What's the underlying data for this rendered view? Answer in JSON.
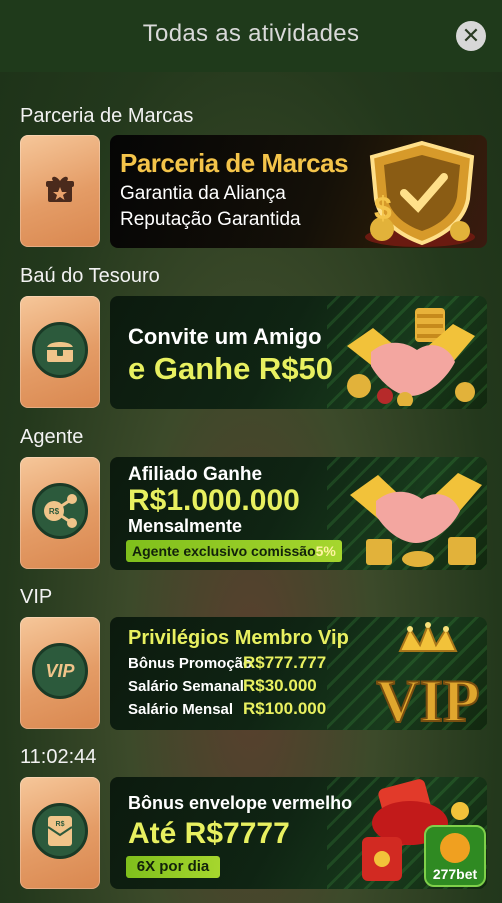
{
  "header": {
    "title": "Todas as atividades",
    "close_icon": "close-icon"
  },
  "sections": [
    {
      "label": "Parceria de Marcas",
      "tile_icon": "gift-icon",
      "banner": {
        "headline": "Parceria de Marcas",
        "line1": "Garantia da Aliança",
        "line2": "Reputação Garantida"
      }
    },
    {
      "label": "Baú do Tesouro",
      "tile_icon": "treasure-chest-icon",
      "banner": {
        "line1": "Convite um Amigo",
        "line2": "e Ganhe R$50"
      }
    },
    {
      "label": "Agente",
      "tile_icon": "share-icon",
      "tile_icon_text": "R$",
      "banner": {
        "line1": "Afiliado Ganhe",
        "line2": "R$1.000.000",
        "line3": "Mensalmente",
        "pill": "Agente exclusivo comissão",
        "pill_value": "5%"
      }
    },
    {
      "label": "VIP",
      "tile_icon": "vip-icon",
      "tile_icon_text": "VIP",
      "banner": {
        "headline": "Privilégios Membro Vip",
        "rows": [
          {
            "label": "Bônus Promoção",
            "value": "R$777.777"
          },
          {
            "label": "Salário Semanal",
            "value": "R$30.000"
          },
          {
            "label": "Salário Mensal",
            "value": "R$100.000"
          }
        ],
        "art_text": "VIP"
      }
    },
    {
      "label": "11:02:44",
      "tile_icon": "red-envelope-icon",
      "tile_icon_text": "R$",
      "banner": {
        "headline": "Bônus envelope vermelho",
        "line2": "Até R$7777",
        "pill": "6X por dia",
        "logo_text": "277bet"
      }
    }
  ],
  "colors": {
    "header_bg": "#1f3a1b",
    "tile_gradient_top": "#f6c79a",
    "tile_gradient_bottom": "#d9874f",
    "banner_yellow": "#e8f060",
    "pill_green": "#a6d62e"
  }
}
